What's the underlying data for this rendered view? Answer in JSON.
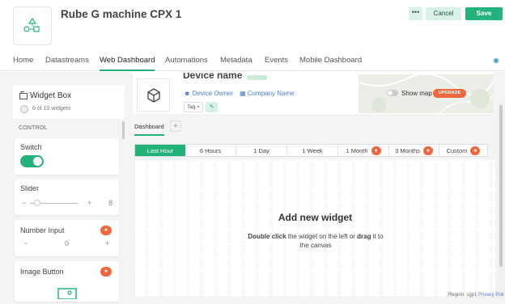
{
  "header": {
    "title": "Rube G machine CPX 1",
    "more_label": "•••",
    "cancel_label": "Cancel",
    "save_label": "Save"
  },
  "tabs": [
    {
      "label": "Home"
    },
    {
      "label": "Datastreams"
    },
    {
      "label": "Web Dashboard",
      "active": true
    },
    {
      "label": "Automations"
    },
    {
      "label": "Metadata"
    },
    {
      "label": "Events"
    },
    {
      "label": "Mobile Dashboard"
    }
  ],
  "widget_box": {
    "title": "Widget Box",
    "count": "0 of 10 widgets",
    "section": "CONTROL",
    "widgets": [
      {
        "label": "Switch"
      },
      {
        "label": "Slider",
        "minus": "−",
        "plus": "+",
        "value": "8"
      },
      {
        "label": "Number Input",
        "minus": "−",
        "plus": "+",
        "value": "0"
      },
      {
        "label": "Image Button"
      }
    ]
  },
  "device": {
    "name": "Device name",
    "owner": "Device Owner",
    "company": "Company Name",
    "tag": "Tag ×",
    "show_map": "Show map",
    "upgrade": "UPGRADE"
  },
  "dashboard": {
    "tab": "Dashboard",
    "add": "+",
    "time_ranges": [
      {
        "label": "Last Hour",
        "active": true,
        "locked": false
      },
      {
        "label": "6 Hours",
        "locked": false
      },
      {
        "label": "1 Day",
        "locked": false
      },
      {
        "label": "1 Week",
        "locked": false
      },
      {
        "label": "1 Month",
        "locked": true
      },
      {
        "label": "3 Months",
        "locked": true
      },
      {
        "label": "Custom",
        "locked": true
      }
    ],
    "empty_title": "Add new widget",
    "empty_desc_b1": "Double click",
    "empty_desc_t1": " the widget on the left or ",
    "empty_desc_b2": "drag",
    "empty_desc_t2": " it to the canvas"
  },
  "footer": {
    "region": "Region: sgp1",
    "privacy": "Privacy Poli"
  },
  "colors": {
    "accent": "#23b37a",
    "accent_light": "#d9f2e7",
    "lock": "#f0673d",
    "link": "#4b7fcf"
  },
  "icons": {
    "lock": "lock-icon",
    "widget_box": "widget-box-icon",
    "device": "cube-icon",
    "image": "image-icon"
  }
}
